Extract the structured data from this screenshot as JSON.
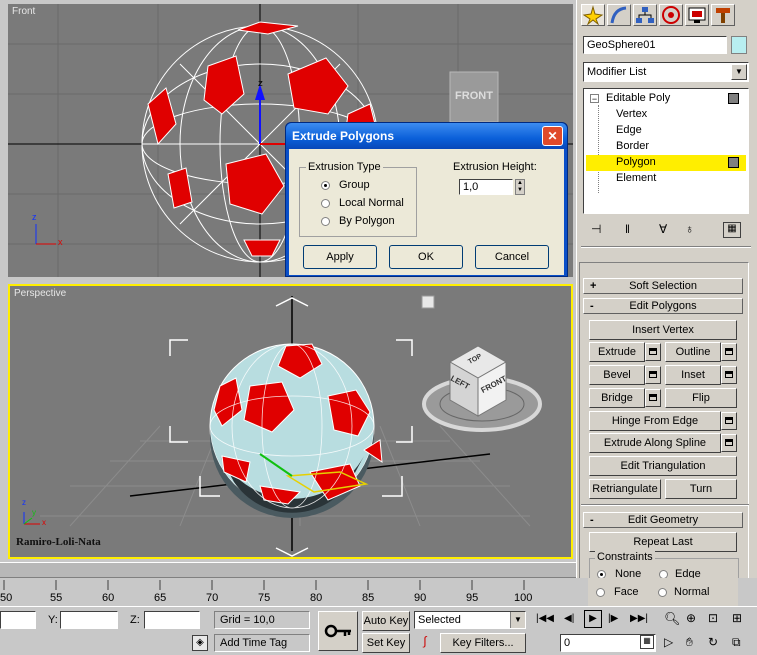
{
  "viewports": {
    "front": {
      "label": "Front",
      "viewcube_label": "FRONT"
    },
    "perspective": {
      "label": "Perspective",
      "viewcube_top": "TOP",
      "viewcube_left": "LEFT",
      "viewcube_front": "FRONT"
    },
    "watermark": "Ramiro-Loli-Nata",
    "axes": {
      "x": "x",
      "y": "y",
      "z": "z"
    }
  },
  "dialog": {
    "title": "Extrude Polygons",
    "group_label": "Extrusion Type",
    "options": [
      "Group",
      "Local Normal",
      "By Polygon"
    ],
    "selected_option": "Group",
    "height_label": "Extrusion Height:",
    "height_value": "1,0",
    "buttons": {
      "apply": "Apply",
      "ok": "OK",
      "cancel": "Cancel"
    },
    "close_glyph": "✕"
  },
  "command_panel": {
    "object_name": "GeoSphere01",
    "modifier_list": "Modifier List",
    "stack": [
      {
        "label": "Editable Poly",
        "level": 0
      },
      {
        "label": "Vertex",
        "level": 1
      },
      {
        "label": "Edge",
        "level": 1
      },
      {
        "label": "Border",
        "level": 1
      },
      {
        "label": "Polygon",
        "level": 1,
        "selected": true
      },
      {
        "label": "Element",
        "level": 1
      }
    ],
    "soft_selection": {
      "sign": "+",
      "label": "Soft Selection"
    },
    "edit_polygons": {
      "sign": "-",
      "label": "Edit Polygons"
    },
    "buttons": {
      "insert_vertex": "Insert Vertex",
      "extrude": "Extrude",
      "outline": "Outline",
      "bevel": "Bevel",
      "inset": "Inset",
      "bridge": "Bridge",
      "flip": "Flip",
      "hinge_from_edge": "Hinge From Edge",
      "extrude_along_spline": "Extrude Along Spline",
      "edit_triangulation": "Edit Triangulation",
      "retriangulate": "Retriangulate",
      "turn": "Turn"
    },
    "edit_geometry": {
      "sign": "-",
      "label": "Edit Geometry"
    },
    "repeat_last": "Repeat Last",
    "constraints": {
      "label": "Constraints",
      "options": [
        "None",
        "Edge",
        "Face",
        "Normal"
      ],
      "selected": "None"
    }
  },
  "timeline": {
    "ticks": [
      "50",
      "55",
      "60",
      "65",
      "70",
      "75",
      "80",
      "85",
      "90",
      "95",
      "100"
    ]
  },
  "status": {
    "y_label": "Y:",
    "z_label": "Z:",
    "grid": "Grid = 10,0",
    "add_time_tag": "Add Time Tag",
    "auto_key": "Auto Key",
    "set_key": "Set Key",
    "selected": "Selected",
    "key_filters": "Key Filters...",
    "frame": "0"
  },
  "colors": {
    "viewport_bg": "#7a7a7a",
    "panel_bg": "#d4d0c8",
    "selection_yellow": "#ffee00",
    "dialog_title_blue": "#0a5fd9",
    "poly_red": "#e00000"
  }
}
